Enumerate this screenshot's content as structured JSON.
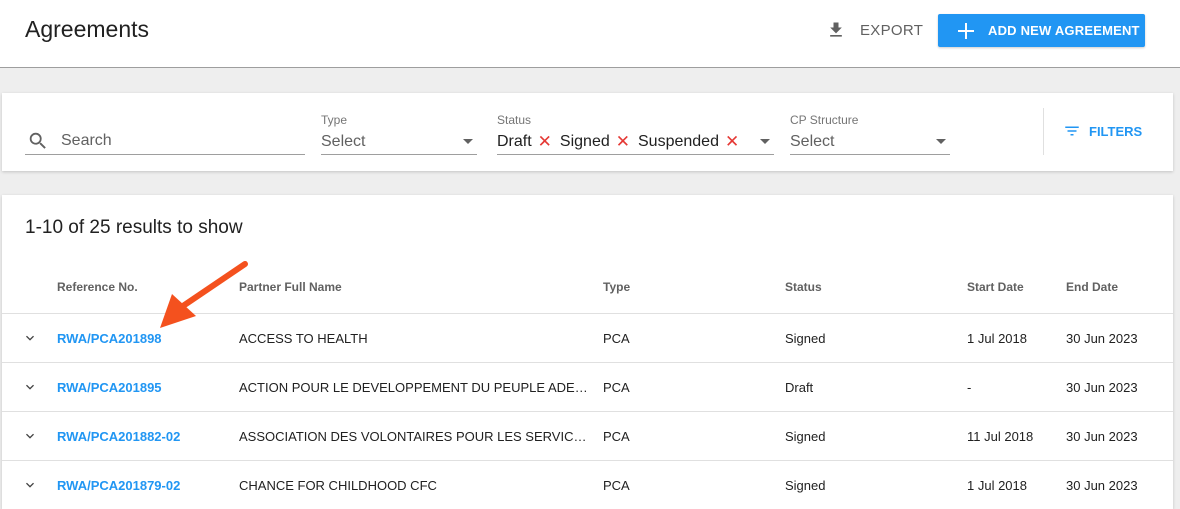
{
  "header": {
    "title": "Agreements",
    "export_label": "EXPORT",
    "add_label": "ADD NEW AGREEMENT"
  },
  "filters": {
    "search_placeholder": "Search",
    "type": {
      "label": "Type",
      "value": "Select"
    },
    "status": {
      "label": "Status",
      "chips": [
        "Draft",
        "Signed",
        "Suspended"
      ]
    },
    "cp_structure": {
      "label": "CP Structure",
      "value": "Select"
    },
    "filters_label": "FILTERS"
  },
  "results": {
    "count_text": "1-10 of 25 results to show",
    "columns": [
      "Reference No.",
      "Partner Full Name",
      "Type",
      "Status",
      "Start Date",
      "End Date"
    ],
    "rows": [
      {
        "ref": "RWA/PCA201898",
        "partner": "ACCESS TO HEALTH",
        "type": "PCA",
        "status": "Signed",
        "start": "1 Jul 2018",
        "end": "30 Jun 2023"
      },
      {
        "ref": "RWA/PCA201895",
        "partner": "ACTION POUR LE DEVELOPPEMENT DU PEUPLE ADEPE",
        "type": "PCA",
        "status": "Draft",
        "start": "-",
        "end": "30 Jun 2023"
      },
      {
        "ref": "RWA/PCA201882-02",
        "partner": "ASSOCIATION DES VOLONTAIRES POUR LES SERVICES IN...",
        "type": "PCA",
        "status": "Signed",
        "start": "11 Jul 2018",
        "end": "30 Jun 2023"
      },
      {
        "ref": "RWA/PCA201879-02",
        "partner": "CHANCE FOR CHILDHOOD CFC",
        "type": "PCA",
        "status": "Signed",
        "start": "1 Jul 2018",
        "end": "30 Jun 2023"
      }
    ]
  },
  "colors": {
    "accent": "#2196f3",
    "chip_remove": "#e53935",
    "annotation_arrow": "#f4511e"
  }
}
